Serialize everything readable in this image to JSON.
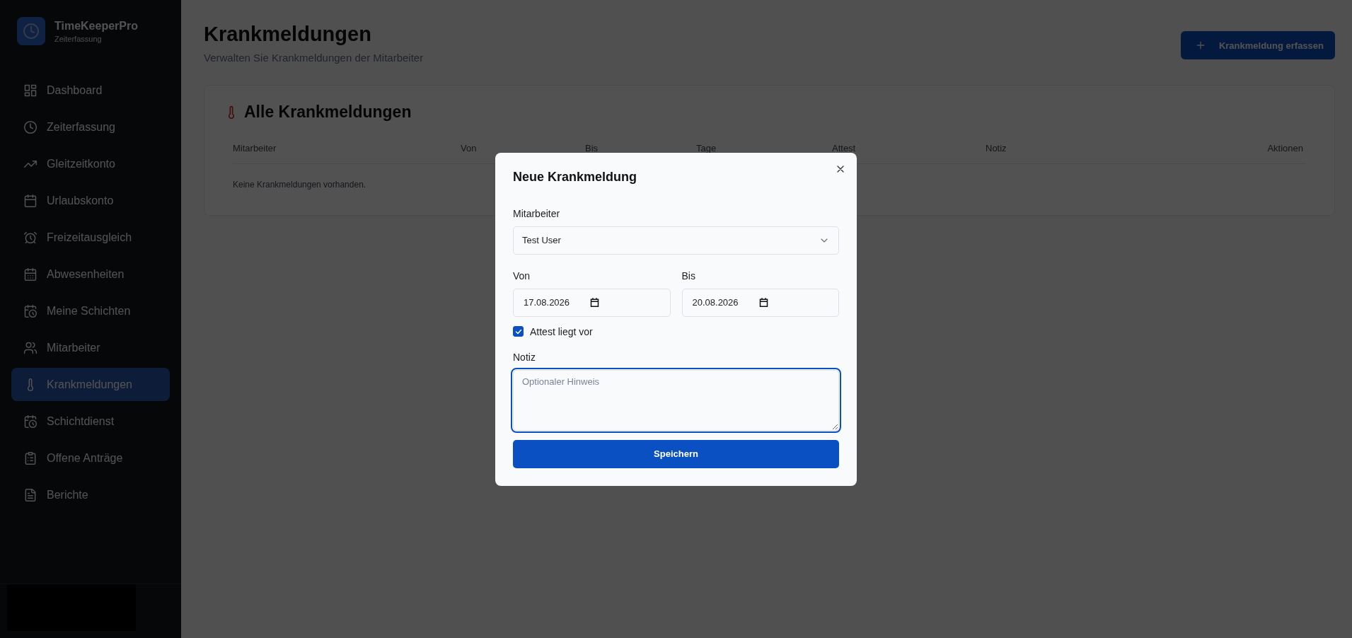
{
  "app": {
    "name": "TimeKeeperPro",
    "subtitle": "Zeiterfassung"
  },
  "sidebar": {
    "items": [
      {
        "label": "Dashboard",
        "selected": false
      },
      {
        "label": "Zeiterfassung",
        "selected": false
      },
      {
        "label": "Gleitzeitkonto",
        "selected": false
      },
      {
        "label": "Urlaubskonto",
        "selected": false
      },
      {
        "label": "Freizeitausgleich",
        "selected": false
      },
      {
        "label": "Abwesenheiten",
        "selected": false
      },
      {
        "label": "Meine Schichten",
        "selected": false
      },
      {
        "label": "Mitarbeiter",
        "selected": false
      },
      {
        "label": "Krankmeldungen",
        "selected": true
      },
      {
        "label": "Schichtdienst",
        "selected": false
      },
      {
        "label": "Offene Anträge",
        "selected": false
      },
      {
        "label": "Berichte",
        "selected": false
      }
    ]
  },
  "page": {
    "title": "Krankmeldungen",
    "subtitle": "Verwalten Sie Krankmeldungen der Mitarbeiter",
    "add_button": "Krankmeldung erfassen"
  },
  "card": {
    "title": "Alle Krankmeldungen",
    "columns": [
      "Mitarbeiter",
      "Von",
      "Bis",
      "Tage",
      "Attest",
      "Notiz",
      "Aktionen"
    ],
    "empty_message": "Keine Krankmeldungen vorhanden."
  },
  "dialog": {
    "title": "Neue Krankmeldung",
    "employee": {
      "label": "Mitarbeiter",
      "value": "Test User"
    },
    "from": {
      "label": "Von",
      "value": "17.08.2026"
    },
    "to": {
      "label": "Bis",
      "value": "20.08.2026"
    },
    "attest": {
      "label": "Attest liegt vor",
      "checked": true
    },
    "note": {
      "label": "Notiz",
      "placeholder": "Optionaler Hinweis",
      "focused": true
    },
    "save_button": "Speichern"
  }
}
